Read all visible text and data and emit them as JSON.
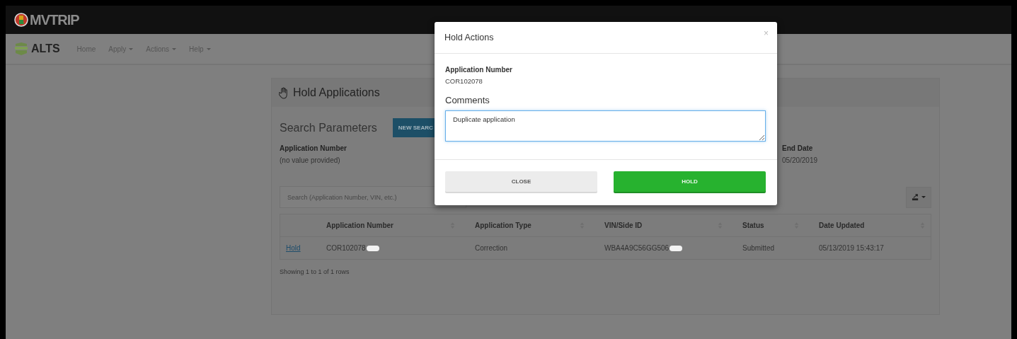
{
  "header": {
    "brand": "MVTRIP"
  },
  "nav": {
    "brand": "ALTS",
    "items": [
      {
        "label": "Home",
        "dropdown": false
      },
      {
        "label": "Apply",
        "dropdown": true
      },
      {
        "label": "Actions",
        "dropdown": true
      },
      {
        "label": "Help",
        "dropdown": true
      }
    ]
  },
  "panel": {
    "title": "Hold Applications",
    "search_parameters": {
      "heading": "Search Parameters",
      "new_search_button": "NEW SEARC",
      "fields": [
        {
          "label": "Application Number",
          "value": "(no value provided)"
        },
        {
          "label": "End Date",
          "value": "05/20/2019"
        }
      ]
    },
    "search": {
      "placeholder": "Search (Application Number, VIN, etc.)"
    },
    "table": {
      "columns": [
        "",
        "Application Number",
        "Application Type",
        "VIN/Side ID",
        "Status",
        "Date Updated"
      ],
      "rows": [
        {
          "cells": [
            {
              "text": "Hold",
              "kind": "link",
              "redacted": false
            },
            {
              "text": "COR102078",
              "kind": "text",
              "redacted": true
            },
            {
              "text": "Correction",
              "kind": "text",
              "redacted": false
            },
            {
              "text": "WBA4A9C56GG506",
              "kind": "text",
              "redacted": true
            },
            {
              "text": "Submitted",
              "kind": "text",
              "redacted": false
            },
            {
              "text": "05/13/2019 15:43:17",
              "kind": "text",
              "redacted": false
            }
          ]
        }
      ]
    },
    "footer": "Showing 1 to 1 of 1 rows"
  },
  "modal": {
    "title": "Hold Actions",
    "close": "×",
    "field_label": "Application Number",
    "field_value": "COR102078",
    "comments_label": "Comments",
    "comments_value": "Duplicate application",
    "buttons": [
      {
        "label": "CLOSE",
        "kind": "secondary"
      },
      {
        "label": "HOLD",
        "kind": "primary"
      }
    ]
  }
}
